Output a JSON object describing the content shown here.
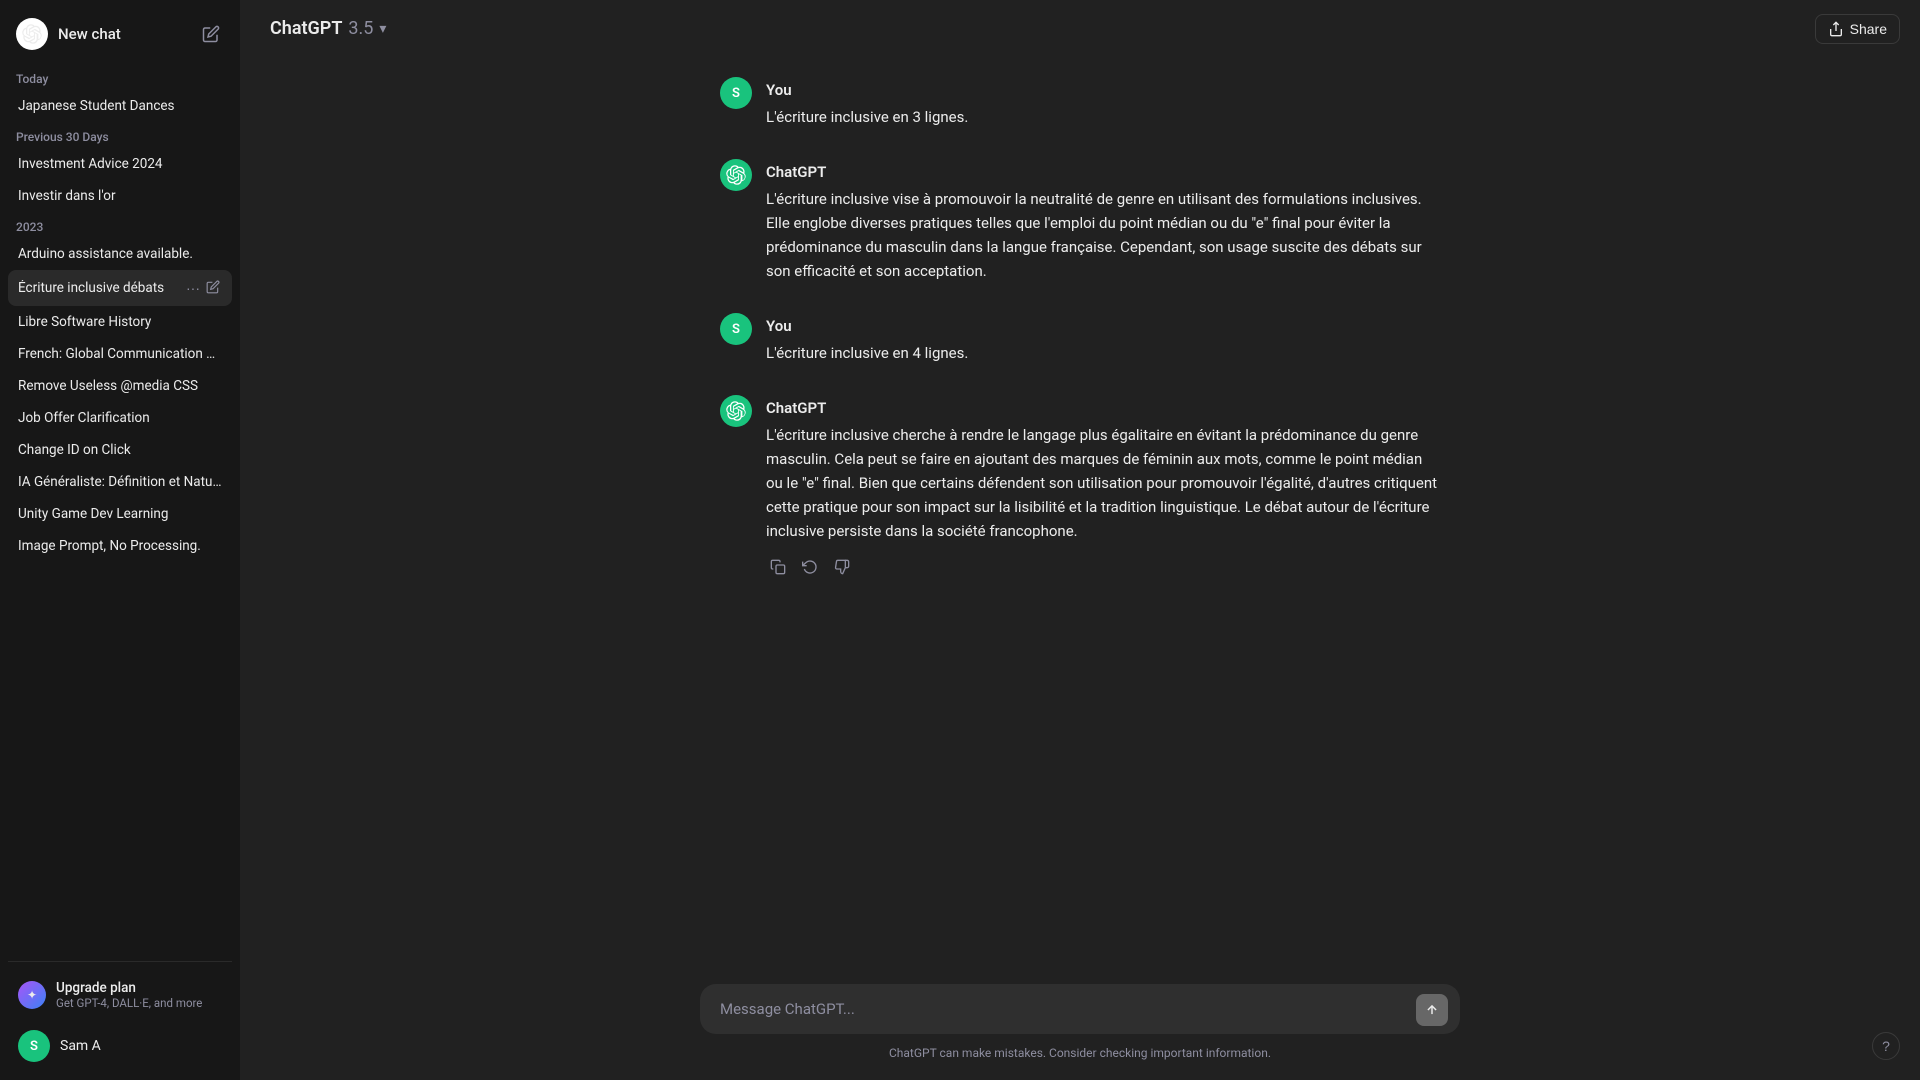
{
  "sidebar": {
    "new_chat_label": "New chat",
    "sections": [
      {
        "label": "Today",
        "items": [
          {
            "id": "japanese-student-dances",
            "text": "Japanese Student Dances",
            "active": false
          }
        ]
      },
      {
        "label": "Previous 30 Days",
        "items": [
          {
            "id": "investment-advice-2024",
            "text": "Investment Advice 2024",
            "active": false
          },
          {
            "id": "investir-dans-lor",
            "text": "Investir dans l'or",
            "active": false
          }
        ]
      },
      {
        "label": "2023",
        "items": [
          {
            "id": "arduino-assistance",
            "text": "Arduino assistance available.",
            "active": false
          },
          {
            "id": "ecriture-inclusive-debats",
            "text": "Écriture inclusive débats",
            "active": true
          },
          {
            "id": "libre-software-history",
            "text": "Libre Software History",
            "active": false
          },
          {
            "id": "french-global-communication",
            "text": "French: Global Communication Key",
            "active": false
          },
          {
            "id": "remove-useless-media-css",
            "text": "Remove Useless @media CSS",
            "active": false
          },
          {
            "id": "job-offer-clarification",
            "text": "Job Offer Clarification",
            "active": false
          },
          {
            "id": "change-id-on-click",
            "text": "Change ID on Click",
            "active": false
          },
          {
            "id": "ia-generaliste",
            "text": "IA Généraliste: Définition et Nature",
            "active": false
          },
          {
            "id": "unity-game-dev",
            "text": "Unity Game Dev Learning",
            "active": false
          },
          {
            "id": "image-prompt-no-processing",
            "text": "Image Prompt, No Processing.",
            "active": false
          }
        ]
      }
    ],
    "upgrade": {
      "title": "Upgrade plan",
      "subtitle": "Get GPT-4, DALL·E, and more"
    },
    "user": {
      "name": "Sam A",
      "initials": "S"
    }
  },
  "header": {
    "model_name": "ChatGPT",
    "model_version": "3.5",
    "share_label": "Share"
  },
  "messages": [
    {
      "id": "msg1",
      "role": "user",
      "sender": "You",
      "text": "L'écriture inclusive en 3 lignes."
    },
    {
      "id": "msg2",
      "role": "assistant",
      "sender": "ChatGPT",
      "text": "L'écriture inclusive vise à promouvoir la neutralité de genre en utilisant des formulations inclusives. Elle englobe diverses pratiques telles que l'emploi du point médian ou du \"e\" final pour éviter la prédominance du masculin dans la langue française. Cependant, son usage suscite des débats sur son efficacité et son acceptation."
    },
    {
      "id": "msg3",
      "role": "user",
      "sender": "You",
      "text": "L'écriture inclusive en 4 lignes."
    },
    {
      "id": "msg4",
      "role": "assistant",
      "sender": "ChatGPT",
      "text": "L'écriture inclusive cherche à rendre le langage plus égalitaire en évitant la prédominance du genre masculin. Cela peut se faire en ajoutant des marques de féminin aux mots, comme le point médian ou le \"e\" final. Bien que certains défendent son utilisation pour promouvoir l'égalité, d'autres critiquent cette pratique pour son impact sur la lisibilité et la tradition linguistique. Le débat autour de l'écriture inclusive persiste dans la société francophone."
    }
  ],
  "input": {
    "placeholder": "Message ChatGPT..."
  },
  "disclaimer": "ChatGPT can make mistakes. Consider checking important information.",
  "help_label": "?"
}
